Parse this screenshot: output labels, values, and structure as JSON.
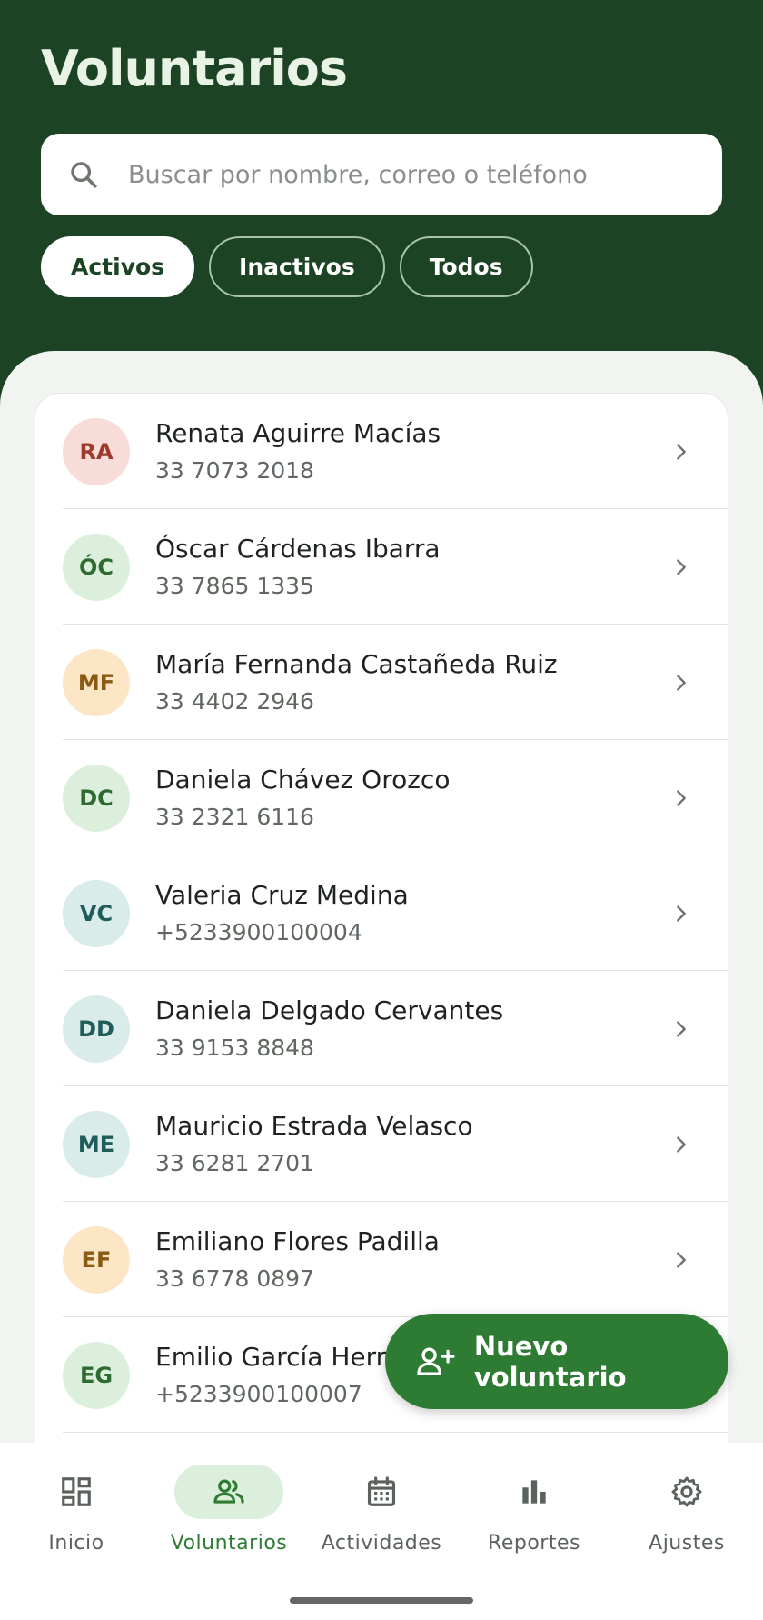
{
  "header": {
    "title": "Voluntarios",
    "search_placeholder": "Buscar por nombre, correo o teléfono"
  },
  "filters": [
    {
      "label": "Activos",
      "active": true
    },
    {
      "label": "Inactivos",
      "active": false
    },
    {
      "label": "Todos",
      "active": false
    }
  ],
  "volunteers": [
    {
      "initials": "RA",
      "name": "Renata Aguirre Macías",
      "phone": "33 7073 2018",
      "avatar_bg": "#f8dcd8",
      "avatar_fg": "#9c3a2b"
    },
    {
      "initials": "ÓC",
      "name": "Óscar Cárdenas Ibarra",
      "phone": "33 7865 1335",
      "avatar_bg": "#dcefdc",
      "avatar_fg": "#2e6b32"
    },
    {
      "initials": "MF",
      "name": "María Fernanda Castañeda Ruiz",
      "phone": "33 4402 2946",
      "avatar_bg": "#fde6c6",
      "avatar_fg": "#8a5a12"
    },
    {
      "initials": "DC",
      "name": "Daniela Chávez Orozco",
      "phone": "33 2321 6116",
      "avatar_bg": "#dcefdc",
      "avatar_fg": "#2e6b32"
    },
    {
      "initials": "VC",
      "name": "Valeria Cruz Medina",
      "phone": "+5233900100004",
      "avatar_bg": "#d9ecea",
      "avatar_fg": "#1f5c5a"
    },
    {
      "initials": "DD",
      "name": "Daniela Delgado Cervantes",
      "phone": "33 9153 8848",
      "avatar_bg": "#d9ecea",
      "avatar_fg": "#1f5c5a"
    },
    {
      "initials": "ME",
      "name": "Mauricio Estrada Velasco",
      "phone": "33 6281 2701",
      "avatar_bg": "#d9ecea",
      "avatar_fg": "#1f5c5a"
    },
    {
      "initials": "EF",
      "name": "Emiliano Flores Padilla",
      "phone": "33 6778 0897",
      "avatar_bg": "#fde6c6",
      "avatar_fg": "#8a5a12"
    },
    {
      "initials": "EG",
      "name": "Emilio García Herre",
      "phone": "+5233900100007",
      "avatar_bg": "#dcefdc",
      "avatar_fg": "#2e6b32"
    }
  ],
  "fab": {
    "label": "Nuevo voluntario",
    "icon": "person-add-icon"
  },
  "nav": [
    {
      "label": "Inicio",
      "icon": "dashboard-icon",
      "active": false
    },
    {
      "label": "Voluntarios",
      "icon": "people-icon",
      "active": true
    },
    {
      "label": "Actividades",
      "icon": "calendar-icon",
      "active": false
    },
    {
      "label": "Reportes",
      "icon": "bar-chart-icon",
      "active": false
    },
    {
      "label": "Ajustes",
      "icon": "gear-icon",
      "active": false
    }
  ],
  "colors": {
    "header_bg": "#1b4324",
    "accent": "#2e7b33",
    "sheet_bg": "#f1f4f0"
  }
}
